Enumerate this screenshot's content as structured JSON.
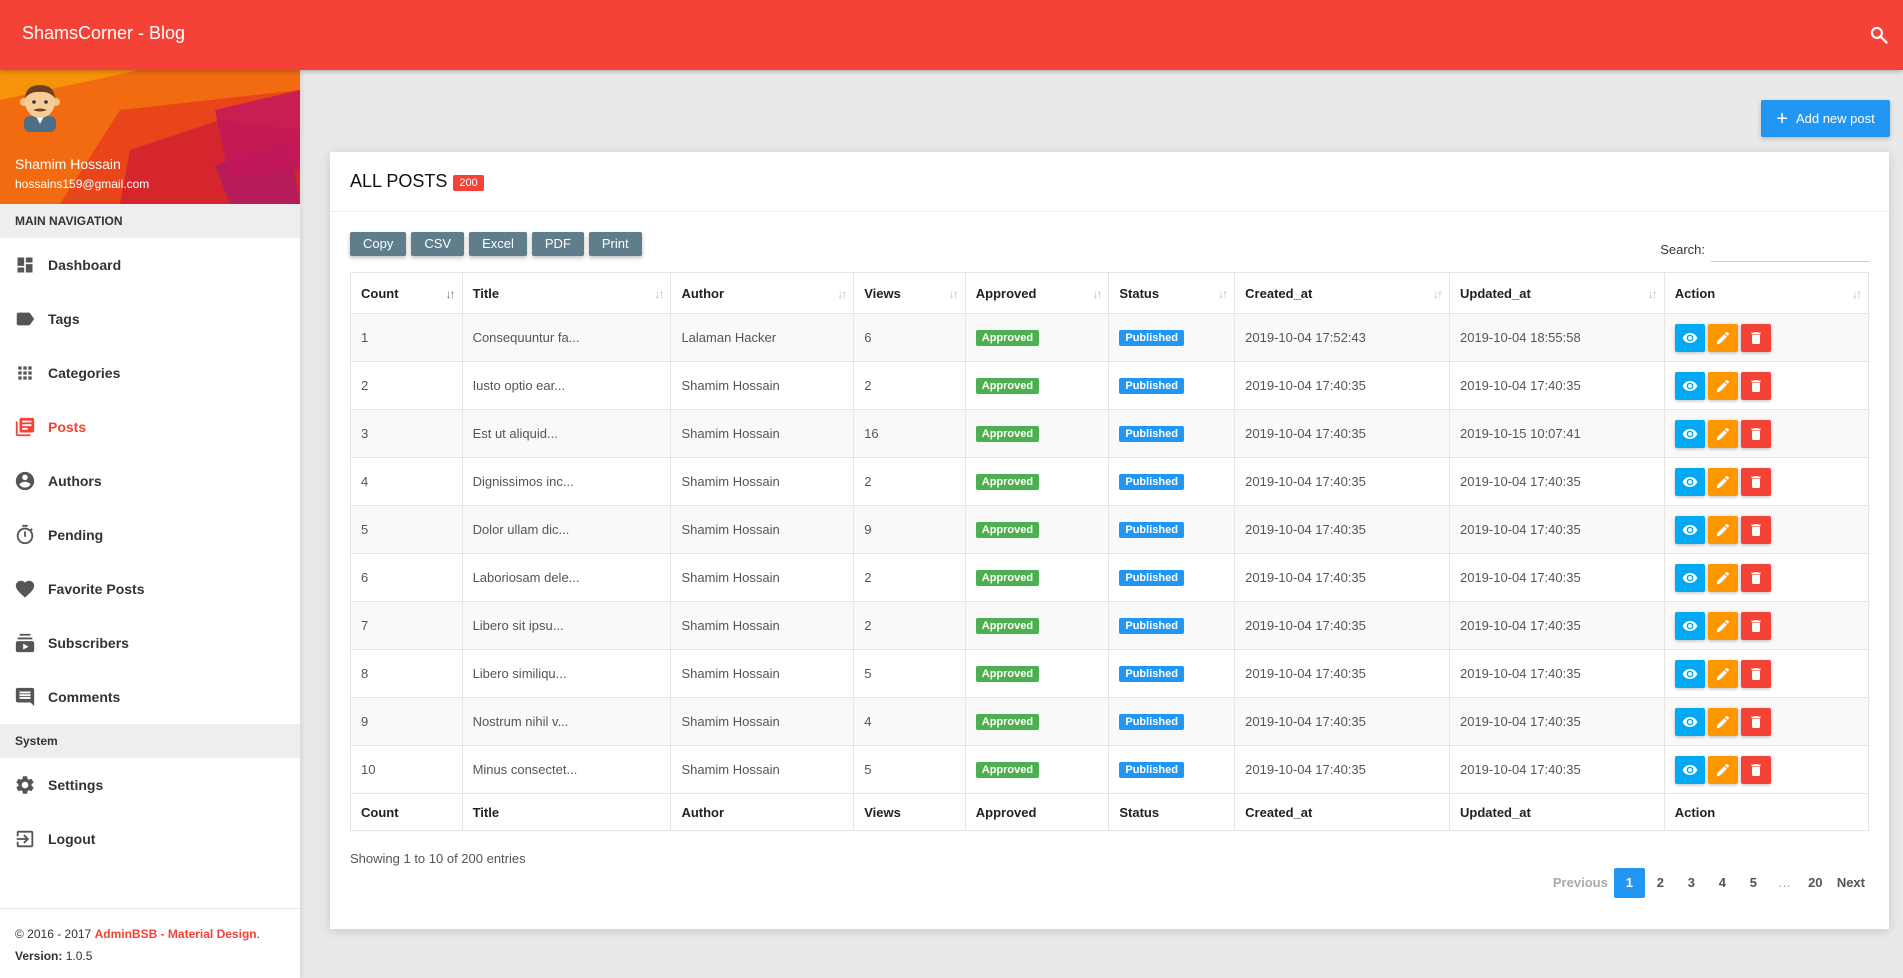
{
  "app": {
    "brand": "ShamsCorner - Blog"
  },
  "user": {
    "name": "Shamim Hossain",
    "email": "hossains159@gmail.com"
  },
  "colors": {
    "primary": "#f44336",
    "accent": "#2196f3",
    "approved": "#4caf50",
    "view": "#03a9f4",
    "edit": "#ff9800",
    "delete": "#f44336",
    "export": "#607d8b"
  },
  "sidebar": {
    "main_header": "MAIN NAVIGATION",
    "system_header": "System",
    "main_items": [
      {
        "label": "Dashboard",
        "icon": "dashboard-icon",
        "active": false
      },
      {
        "label": "Tags",
        "icon": "label-icon",
        "active": false
      },
      {
        "label": "Categories",
        "icon": "apps-icon",
        "active": false
      },
      {
        "label": "Posts",
        "icon": "library-books-icon",
        "active": true
      },
      {
        "label": "Authors",
        "icon": "account-circle-icon",
        "active": false
      },
      {
        "label": "Pending",
        "icon": "timer-icon",
        "active": false
      },
      {
        "label": "Favorite Posts",
        "icon": "heart-icon",
        "active": false
      },
      {
        "label": "Subscribers",
        "icon": "subscriptions-icon",
        "active": false
      },
      {
        "label": "Comments",
        "icon": "comment-icon",
        "active": false
      }
    ],
    "system_items": [
      {
        "label": "Settings",
        "icon": "gear-icon"
      },
      {
        "label": "Logout",
        "icon": "logout-icon"
      }
    ],
    "footer": {
      "copyright": "© 2016 - 2017",
      "brand": "AdminBSB - Material Design",
      "version_label": "Version:",
      "version": "1.0.5"
    }
  },
  "content": {
    "add_button": "Add new post",
    "card_title": "ALL POSTS",
    "post_count": "200",
    "export_buttons": [
      "Copy",
      "CSV",
      "Excel",
      "PDF",
      "Print"
    ],
    "search_label": "Search:",
    "search_value": "",
    "table": {
      "columns": [
        "Count",
        "Title",
        "Author",
        "Views",
        "Approved",
        "Status",
        "Created_at",
        "Updated_at",
        "Action"
      ],
      "rows": [
        {
          "count": "1",
          "title": "Consequuntur fa...",
          "author": "Lalaman Hacker",
          "views": "6",
          "approved": "Approved",
          "status": "Published",
          "created": "2019-10-04 17:52:43",
          "updated": "2019-10-04 18:55:58"
        },
        {
          "count": "2",
          "title": "Iusto optio ear...",
          "author": "Shamim Hossain",
          "views": "2",
          "approved": "Approved",
          "status": "Published",
          "created": "2019-10-04 17:40:35",
          "updated": "2019-10-04 17:40:35"
        },
        {
          "count": "3",
          "title": "Est ut aliquid...",
          "author": "Shamim Hossain",
          "views": "16",
          "approved": "Approved",
          "status": "Published",
          "created": "2019-10-04 17:40:35",
          "updated": "2019-10-15 10:07:41"
        },
        {
          "count": "4",
          "title": "Dignissimos inc...",
          "author": "Shamim Hossain",
          "views": "2",
          "approved": "Approved",
          "status": "Published",
          "created": "2019-10-04 17:40:35",
          "updated": "2019-10-04 17:40:35"
        },
        {
          "count": "5",
          "title": "Dolor ullam dic...",
          "author": "Shamim Hossain",
          "views": "9",
          "approved": "Approved",
          "status": "Published",
          "created": "2019-10-04 17:40:35",
          "updated": "2019-10-04 17:40:35"
        },
        {
          "count": "6",
          "title": "Laboriosam dele...",
          "author": "Shamim Hossain",
          "views": "2",
          "approved": "Approved",
          "status": "Published",
          "created": "2019-10-04 17:40:35",
          "updated": "2019-10-04 17:40:35"
        },
        {
          "count": "7",
          "title": "Libero sit ipsu...",
          "author": "Shamim Hossain",
          "views": "2",
          "approved": "Approved",
          "status": "Published",
          "created": "2019-10-04 17:40:35",
          "updated": "2019-10-04 17:40:35"
        },
        {
          "count": "8",
          "title": "Libero similiqu...",
          "author": "Shamim Hossain",
          "views": "5",
          "approved": "Approved",
          "status": "Published",
          "created": "2019-10-04 17:40:35",
          "updated": "2019-10-04 17:40:35"
        },
        {
          "count": "9",
          "title": "Nostrum nihil v...",
          "author": "Shamim Hossain",
          "views": "4",
          "approved": "Approved",
          "status": "Published",
          "created": "2019-10-04 17:40:35",
          "updated": "2019-10-04 17:40:35"
        },
        {
          "count": "10",
          "title": "Minus consectet...",
          "author": "Shamim Hossain",
          "views": "5",
          "approved": "Approved",
          "status": "Published",
          "created": "2019-10-04 17:40:35",
          "updated": "2019-10-04 17:40:35"
        }
      ]
    },
    "info": "Showing 1 to 10 of 200 entries",
    "pagination": {
      "previous": "Previous",
      "next": "Next",
      "pages": [
        "1",
        "2",
        "3",
        "4",
        "5",
        "…",
        "20"
      ],
      "current": "1"
    }
  }
}
